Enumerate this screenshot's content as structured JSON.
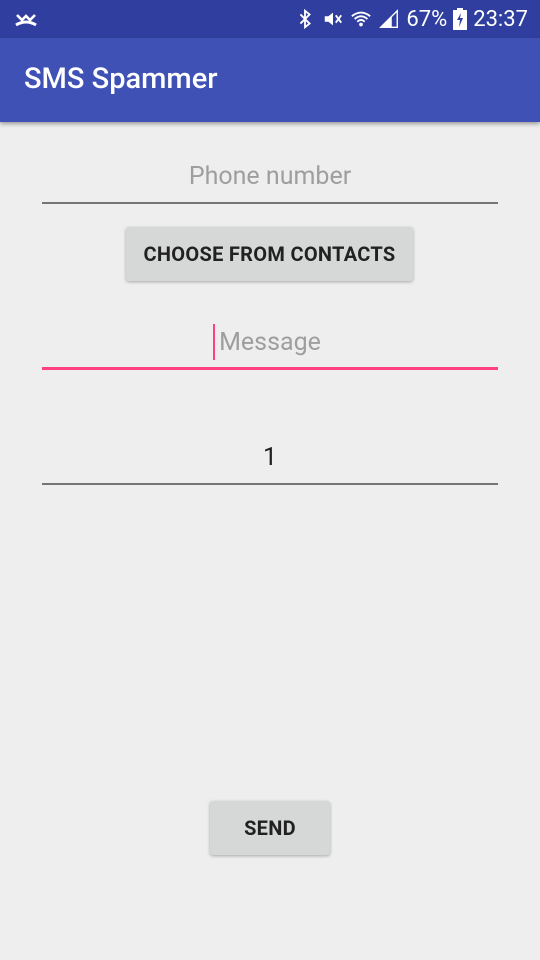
{
  "status_bar": {
    "left_icon": "missed-call-icon",
    "icons": [
      "bluetooth-icon",
      "vibrate-icon",
      "wifi-icon",
      "signal-icon"
    ],
    "battery_percent": "67%",
    "battery_icon": "battery-charging-icon",
    "time": "23:37"
  },
  "app_bar": {
    "title": "SMS Spammer"
  },
  "form": {
    "phone_placeholder": "Phone number",
    "phone_value": "",
    "choose_contacts_label": "CHOOSE FROM CONTACTS",
    "message_placeholder": "Message",
    "message_value": "",
    "count_value": "1",
    "send_label": "SEND"
  },
  "colors": {
    "status_bar": "#303f9f",
    "app_bar": "#3f51b5",
    "accent": "#ff4081",
    "background": "#eeeeee",
    "button": "#d6d7d7"
  }
}
